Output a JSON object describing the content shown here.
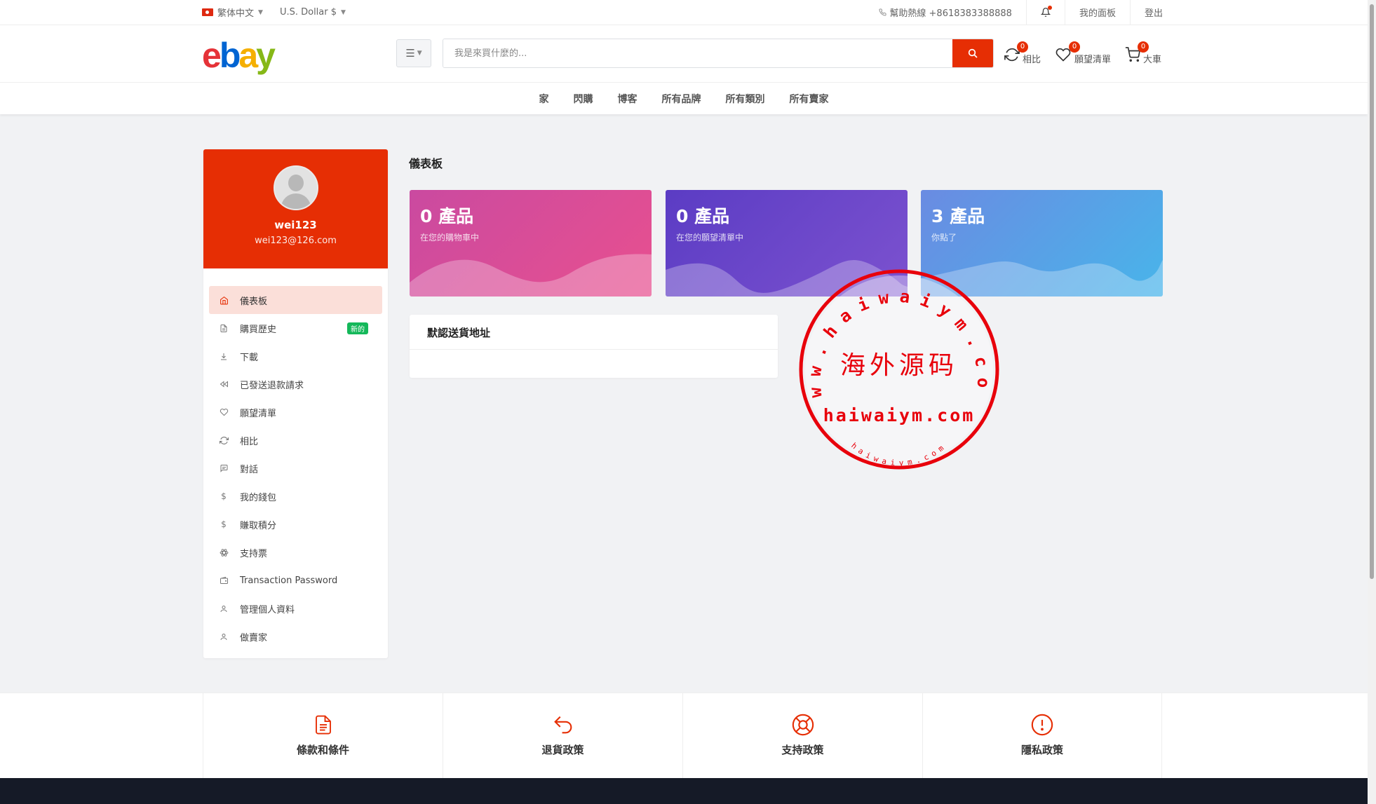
{
  "topbar": {
    "language": "繁体中文",
    "currency": "U.S. Dollar $",
    "helpline": "幫助熱線 +8618383388888",
    "dashboard_link": "我的面板",
    "logout": "登出"
  },
  "header": {
    "logo": [
      "e",
      "b",
      "a",
      "y"
    ],
    "search_placeholder": "我是來買什麼的...",
    "compare": {
      "label": "相比",
      "count": "0"
    },
    "wishlist": {
      "label": "願望清單",
      "count": "0"
    },
    "cart": {
      "label": "大車",
      "count": "0"
    }
  },
  "nav": [
    "家",
    "閃購",
    "博客",
    "所有品牌",
    "所有類別",
    "所有賣家"
  ],
  "profile": {
    "name": "wei123",
    "email": "wei123@126.com"
  },
  "sidebar": {
    "items": [
      {
        "label": "儀表板",
        "icon": "home-icon"
      },
      {
        "label": "購買歷史",
        "icon": "file-icon",
        "badge": "新的"
      },
      {
        "label": "下載",
        "icon": "download-icon"
      },
      {
        "label": "已發送退款請求",
        "icon": "backward-icon"
      },
      {
        "label": "願望清單",
        "icon": "heart-icon"
      },
      {
        "label": "相比",
        "icon": "refresh-icon"
      },
      {
        "label": "對話",
        "icon": "chat-icon"
      },
      {
        "label": "我的錢包",
        "icon": "dollar-icon"
      },
      {
        "label": "賺取積分",
        "icon": "dollar-icon"
      },
      {
        "label": "支持票",
        "icon": "atom-icon"
      },
      {
        "label": "Transaction Password",
        "icon": "wallet-icon"
      },
      {
        "label": "管理個人資料",
        "icon": "user-icon"
      },
      {
        "label": "做賣家",
        "icon": "user-icon"
      }
    ]
  },
  "main": {
    "title": "儀表板",
    "cards": [
      {
        "count": "0 產品",
        "desc": "在您的購物車中"
      },
      {
        "count": "0 產品",
        "desc": "在您的願望清單中"
      },
      {
        "count": "3 產品",
        "desc": "你點了"
      }
    ],
    "address_title": "默認送貨地址"
  },
  "stamp": {
    "outer_text": "www.haiwaiym.com",
    "center_text": "海外源码",
    "domain_text": "haiwaiym.com",
    "small_text": "haiwaiym.com"
  },
  "footer": [
    {
      "label": "條款和條件",
      "icon": "document-icon"
    },
    {
      "label": "退貨政策",
      "icon": "return-icon"
    },
    {
      "label": "支持政策",
      "icon": "lifebuoy-icon"
    },
    {
      "label": "隱私政策",
      "icon": "exclamation-icon"
    }
  ],
  "colors": {
    "accent": "#e62e04",
    "new_badge": "#14b85a",
    "footer_dark": "#151a27"
  }
}
